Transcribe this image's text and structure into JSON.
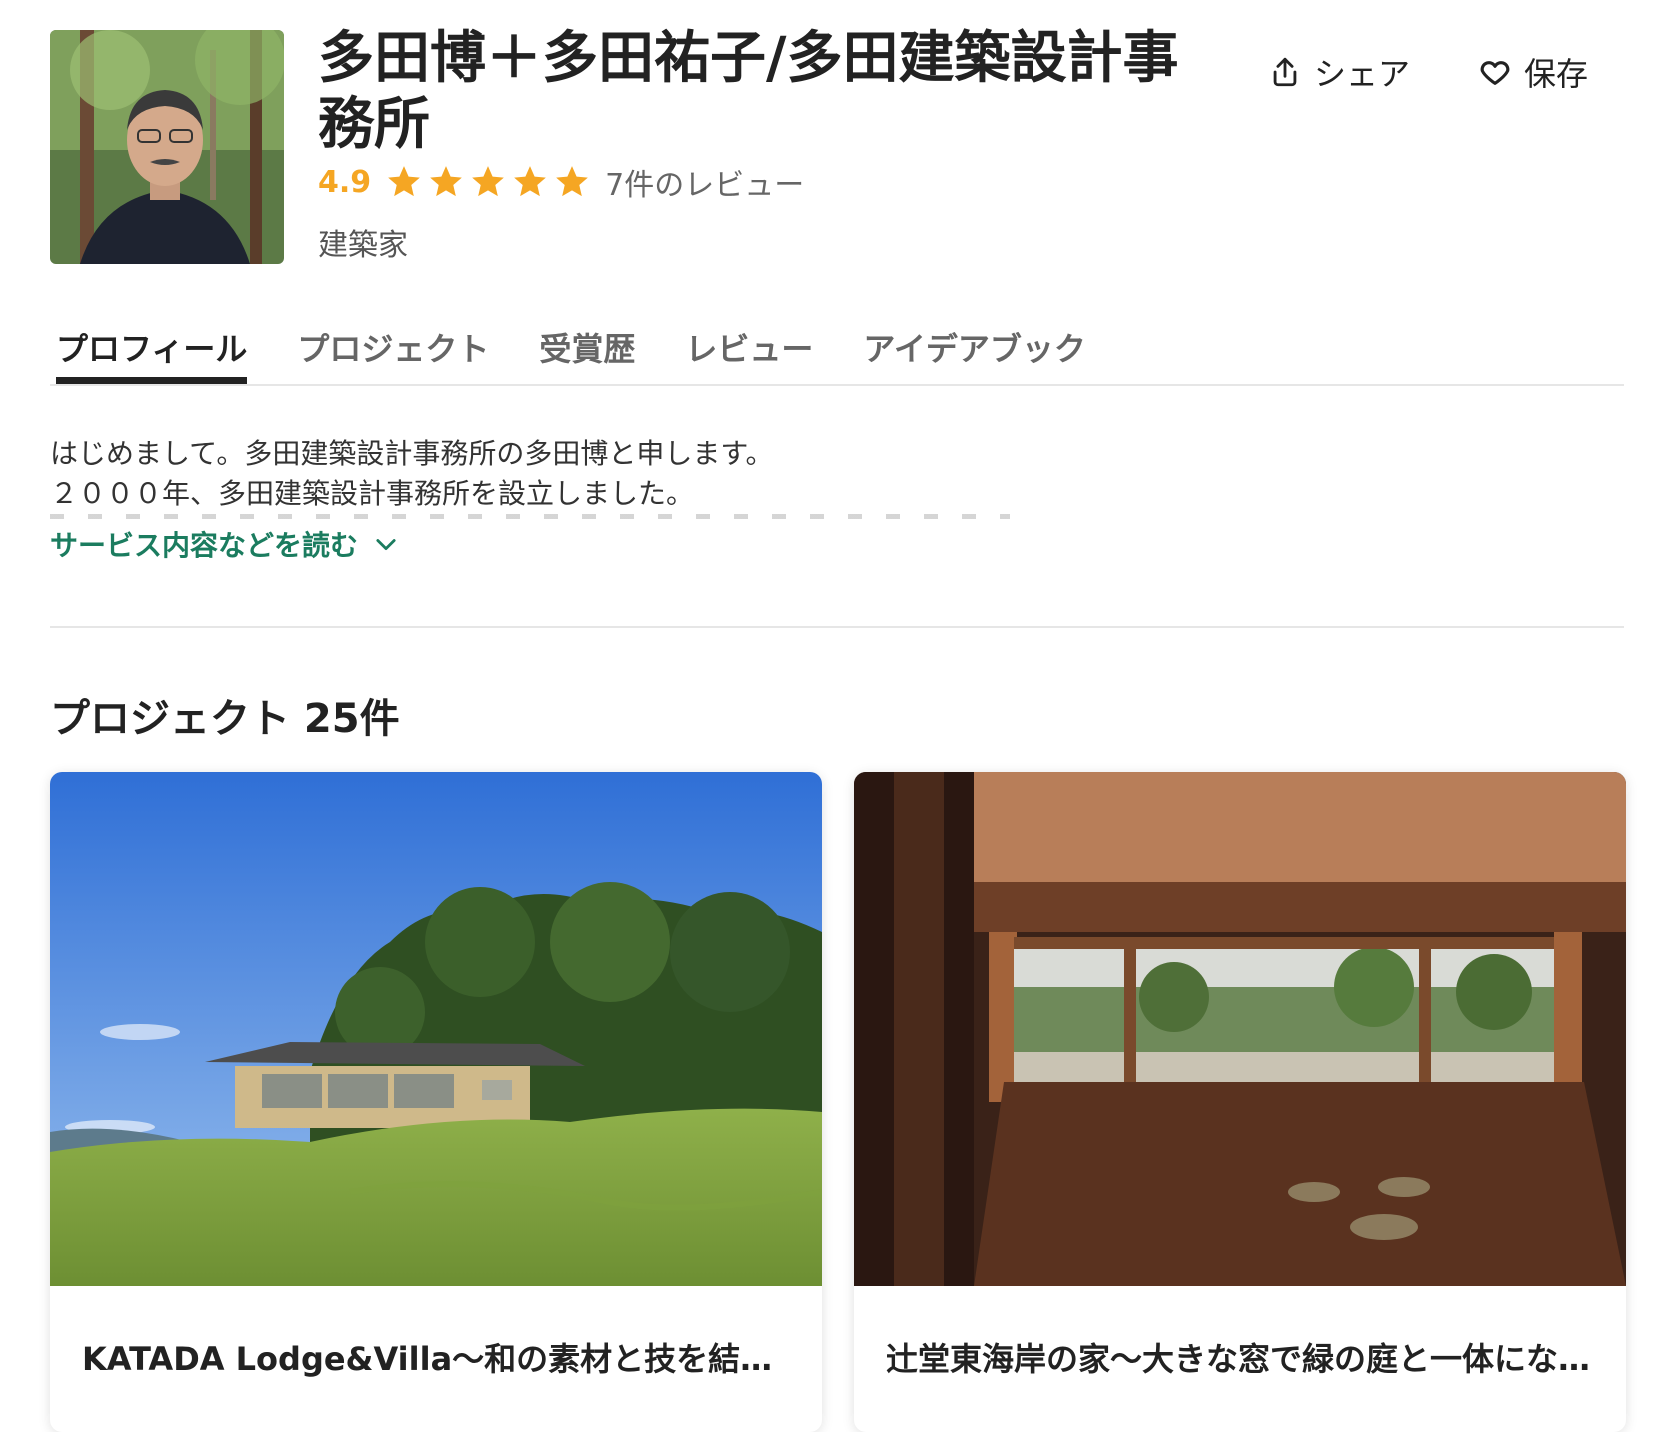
{
  "header": {
    "title": "多田博＋多田祐子/多田建築設計事務所",
    "rating_value": "4.9",
    "rating_stars": 5,
    "review_count": "7件のレビュー",
    "category": "建築家",
    "share_label": "シェア",
    "save_label": "保存"
  },
  "tabs": [
    {
      "label": "プロフィール",
      "active": true
    },
    {
      "label": "プロジェクト",
      "active": false
    },
    {
      "label": "受賞歴",
      "active": false
    },
    {
      "label": "レビュー",
      "active": false
    },
    {
      "label": "アイデアブック",
      "active": false
    }
  ],
  "about": {
    "line1": "はじめまして。多田建築設計事務所の多田博と申します。",
    "line2": "２０００年、多田建築設計事務所を設立しました。",
    "read_more": "サービス内容などを読む"
  },
  "projects": {
    "heading": "プロジェクト 25件",
    "cards": [
      {
        "title": "KATADA Lodge&Villa〜和の素材と技を結集した山荘"
      },
      {
        "title": "辻堂東海岸の家〜大きな窓で緑の庭と一体になる住まい"
      }
    ]
  },
  "colors": {
    "accent_green": "#1b7c5f",
    "star_orange": "#f5a623",
    "text_dark": "#222222"
  },
  "icons": [
    "share-icon",
    "heart-icon",
    "star-icon",
    "chevron-down-icon"
  ]
}
